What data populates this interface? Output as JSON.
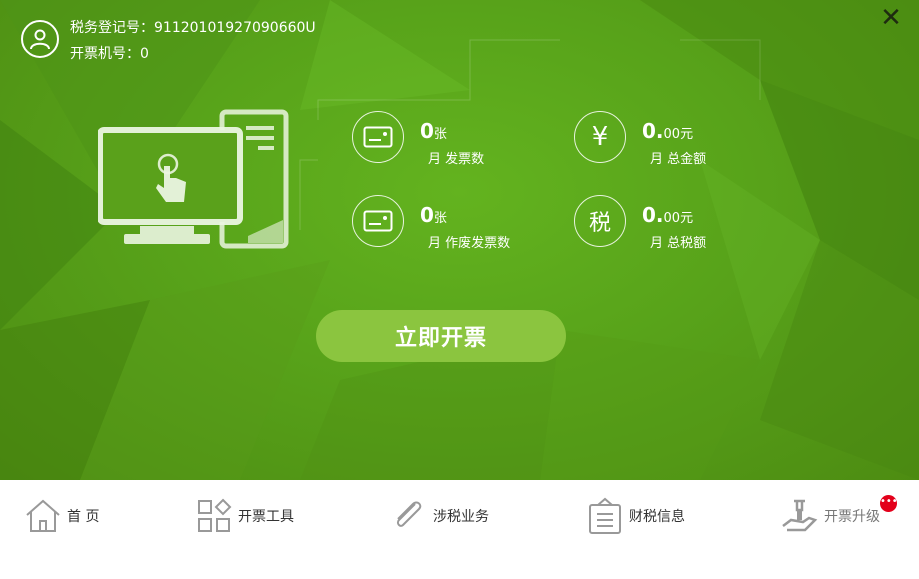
{
  "header": {
    "tax_id_label": "税务登记号：",
    "tax_id_value": "91120101927090660U",
    "machine_no_label": "开票机号：",
    "machine_no_value": "0",
    "close_glyph": "✕"
  },
  "stats": [
    {
      "icon": "invoice-card-icon",
      "value": "0",
      "unit": "张",
      "label": "月 发票数"
    },
    {
      "icon": "yen-icon",
      "glyph": "¥",
      "value": "0.",
      "value_small": "00",
      "unit": "元",
      "label": "月 总金额"
    },
    {
      "icon": "void-invoice-card-icon",
      "value": "0",
      "unit": "张",
      "label": "月 作废发票数"
    },
    {
      "icon": "tax-icon",
      "glyph": "税",
      "value": "0.",
      "value_small": "00",
      "unit": "元",
      "label": "月 总税额"
    }
  ],
  "cta_label": "立即开票",
  "nav": [
    {
      "icon": "home-icon",
      "label": "首 页"
    },
    {
      "icon": "tools-grid-icon",
      "label": "开票工具"
    },
    {
      "icon": "paperclip-icon",
      "label": "涉税业务"
    },
    {
      "icon": "notice-board-icon",
      "label": "财税信息"
    },
    {
      "icon": "upgrade-hand-wrench-icon",
      "label": "开票升级",
      "badge": "•••"
    }
  ],
  "colors": {
    "hero_green": "#58a31a",
    "cta_green": "#8bc53f",
    "badge_red": "#e3001b"
  }
}
